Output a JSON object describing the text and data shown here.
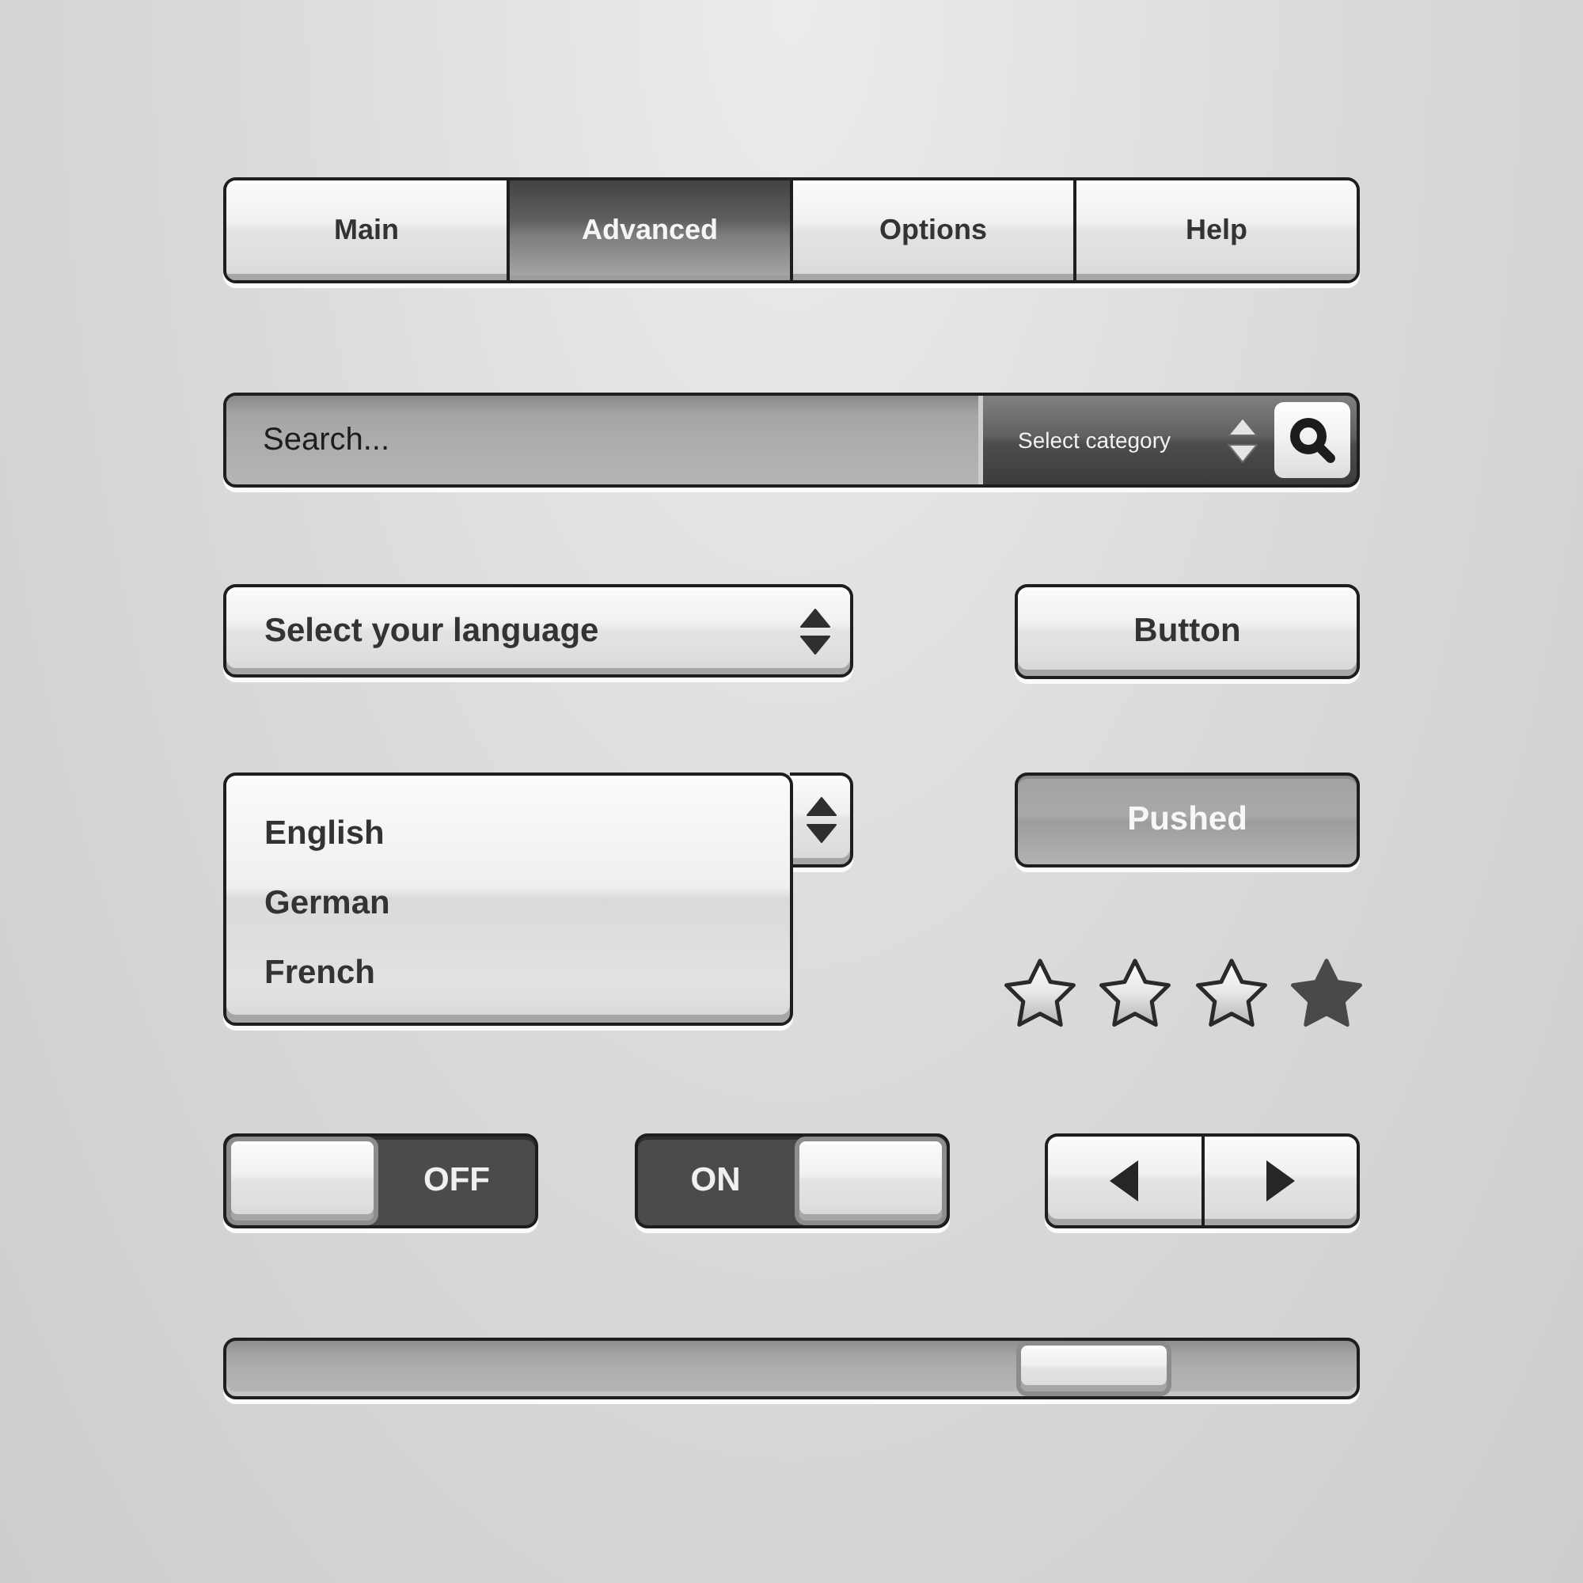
{
  "tabs": [
    {
      "label": "Main",
      "selected": false
    },
    {
      "label": "Advanced",
      "selected": true
    },
    {
      "label": "Options",
      "selected": false
    },
    {
      "label": "Help",
      "selected": false
    }
  ],
  "search": {
    "placeholder": "Search...",
    "category": "Select category"
  },
  "language_select": {
    "label": "Select your language"
  },
  "language_list": {
    "items": [
      {
        "label": "English"
      },
      {
        "label": "German"
      },
      {
        "label": "French"
      }
    ]
  },
  "buttons": [
    {
      "label": "Button",
      "pushed": false
    },
    {
      "label": "Pushed",
      "pushed": true
    }
  ],
  "rating": {
    "stars": 1
  },
  "toggles": [
    {
      "label": "OFF",
      "on": false
    },
    {
      "label": "ON",
      "on": true
    }
  ],
  "slider": {
    "level": 0.81
  }
}
